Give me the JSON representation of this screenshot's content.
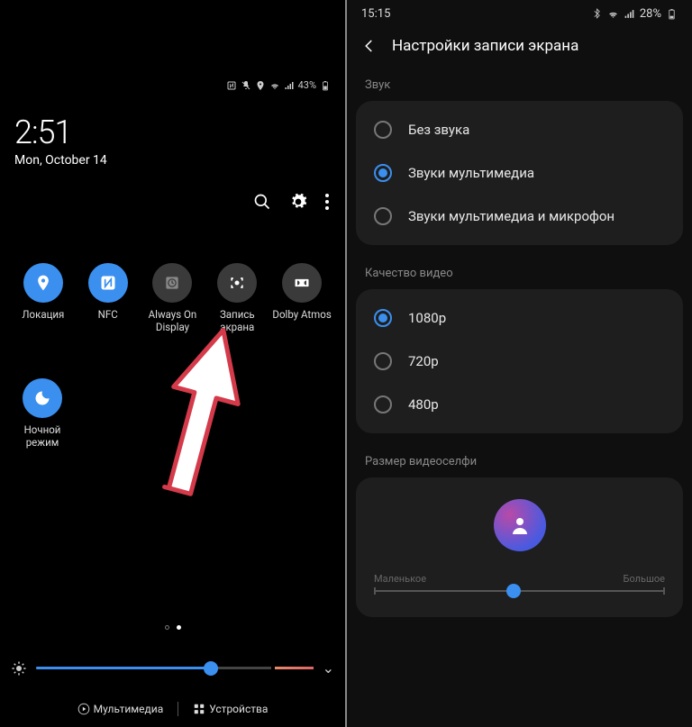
{
  "left": {
    "status": {
      "battery_pct": "43%"
    },
    "clock": {
      "time": "2:51",
      "date": "Mon, October 14"
    },
    "tiles": [
      {
        "id": "location",
        "label": "Локация",
        "on": true,
        "icon": "pin"
      },
      {
        "id": "nfc",
        "label": "NFC",
        "on": true,
        "icon": "nfc"
      },
      {
        "id": "aod",
        "label": "Always On Display",
        "on": false,
        "icon": "clock"
      },
      {
        "id": "screen-record",
        "label": "Запись экрана",
        "on": false,
        "icon": "record"
      },
      {
        "id": "dolby",
        "label": "Dolby Atmos",
        "on": false,
        "icon": "dolby"
      },
      {
        "id": "night",
        "label": "Ночной режим",
        "on": true,
        "icon": "moon"
      }
    ],
    "bottom": {
      "multimedia": "Мультимедиа",
      "devices": "Устройства"
    }
  },
  "right": {
    "status": {
      "time": "15:15",
      "battery_pct": "28%"
    },
    "title": "Настройки записи экрана",
    "sound": {
      "label": "Звук",
      "options": [
        {
          "label": "Без звука",
          "selected": false
        },
        {
          "label": "Звуки мультимедиа",
          "selected": true
        },
        {
          "label": "Звуки мультимедиа и микрофон",
          "selected": false
        }
      ]
    },
    "quality": {
      "label": "Качество видео",
      "options": [
        {
          "label": "1080p",
          "selected": true
        },
        {
          "label": "720p",
          "selected": false
        },
        {
          "label": "480p",
          "selected": false
        }
      ]
    },
    "selfie": {
      "label": "Размер видеоселфи",
      "min_label": "Маленькое",
      "max_label": "Большое"
    }
  }
}
